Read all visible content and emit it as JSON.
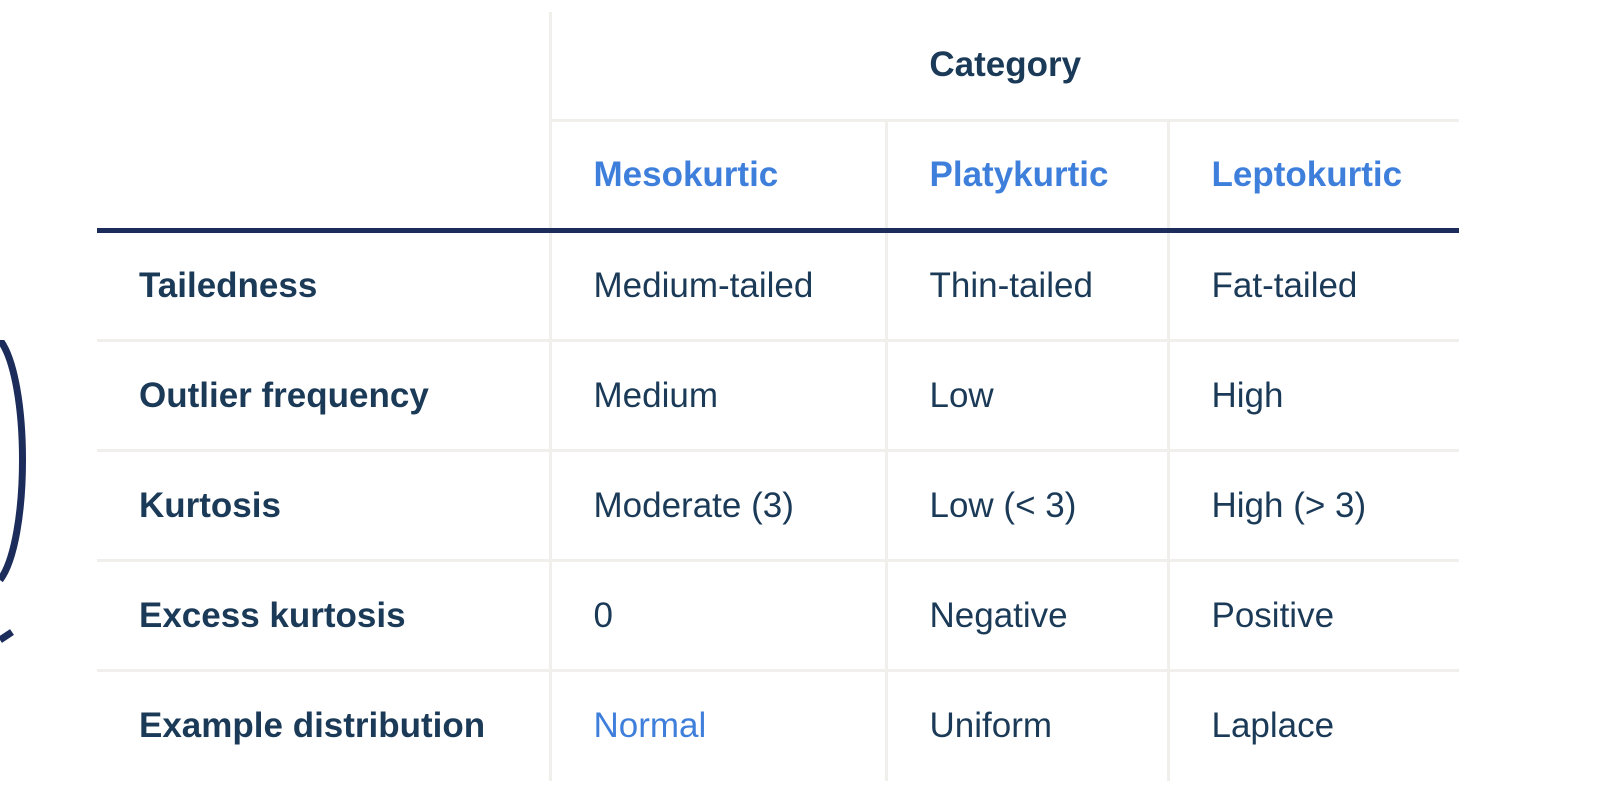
{
  "table": {
    "group_header": "Category",
    "columns": [
      "Mesokurtic",
      "Platykurtic",
      "Leptokurtic"
    ],
    "rows": [
      {
        "label": "Tailedness",
        "values": [
          "Medium-tailed",
          "Thin-tailed",
          "Fat-tailed"
        ]
      },
      {
        "label": "Outlier frequency",
        "values": [
          "Medium",
          "Low",
          "High"
        ]
      },
      {
        "label": "Kurtosis",
        "values": [
          "Moderate (3)",
          "Low (< 3)",
          "High (> 3)"
        ]
      },
      {
        "label": "Excess kurtosis",
        "values": [
          "0",
          "Negative",
          "Positive"
        ]
      },
      {
        "label": "Example distribution",
        "values": [
          "Normal",
          "Uniform",
          "Laplace"
        ]
      }
    ]
  },
  "colors": {
    "text": "#1b3a57",
    "accent": "#3f7fdc",
    "header_rule": "#1c2d5c",
    "grid": "#f0efec"
  }
}
